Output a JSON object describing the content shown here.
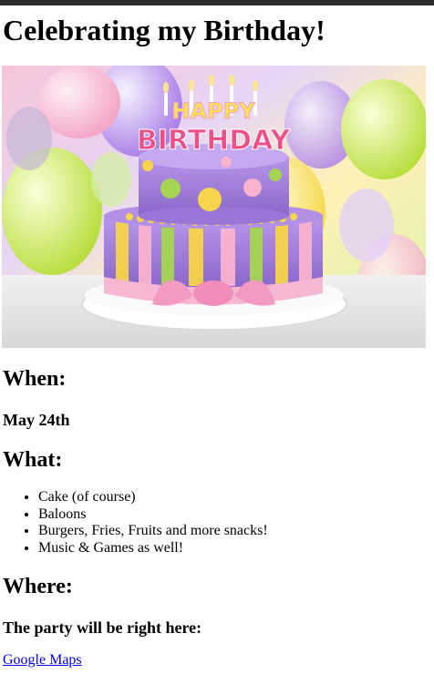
{
  "page": {
    "title": "Celebrating my Birthday!",
    "hero_image": {
      "alt": "Birthday cake",
      "topper_text": "HAPPY BIRTHDAY"
    }
  },
  "when": {
    "heading": "When:",
    "date": "May 24th"
  },
  "what": {
    "heading": "What:",
    "items": [
      "Cake (of course)",
      "Baloons",
      "Burgers, Fries, Fruits and more snacks!",
      "Music & Games as well!"
    ]
  },
  "where": {
    "heading": "Where:",
    "text": "The party will be right here:",
    "link_label": "Google Maps"
  }
}
